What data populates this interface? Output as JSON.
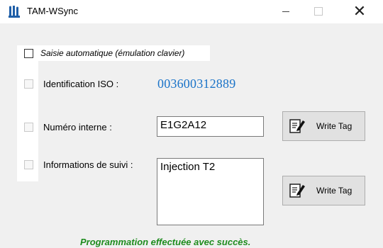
{
  "window": {
    "title": "TAM-WSync",
    "controls": {
      "minimize": "",
      "maximize": "",
      "close": "✕"
    }
  },
  "auto_input": {
    "label": "Saisie automatique (émulation clavier)",
    "checked": false
  },
  "fields": {
    "iso": {
      "label": "Identification ISO :",
      "value": "003600312889"
    },
    "internal": {
      "label": "Numéro interne :",
      "value": "E1G2A12"
    },
    "tracking": {
      "label": "Informations de suivi :",
      "value": "Injection T2"
    }
  },
  "buttons": {
    "write_tag_1": "Write Tag",
    "write_tag_2": "Write Tag"
  },
  "status": {
    "message": "Programmation effectuée avec succès.",
    "color": "#1e8c1e"
  },
  "colors": {
    "iso_value": "#1a73c8",
    "window_bg": "#f0f0f0"
  }
}
